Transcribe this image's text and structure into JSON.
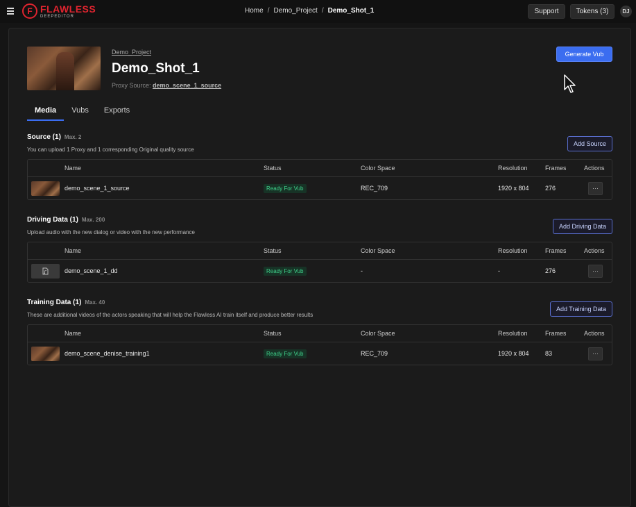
{
  "topbar": {
    "logo_main": "FLAWLESS",
    "logo_sub": "DEEPEDITOR",
    "logo_mark": "F",
    "breadcrumb": [
      "Home",
      "Demo_Project",
      "Demo_Shot_1"
    ],
    "support_label": "Support",
    "tokens_label": "Tokens (3)",
    "avatar_initials": "DJ"
  },
  "shot": {
    "project_link": "Demo_Project",
    "title": "Demo_Shot_1",
    "proxy_label": "Proxy Source:",
    "proxy_value": "demo_scene_1_source",
    "generate_label": "Generate Vub"
  },
  "tabs": [
    {
      "label": "Media",
      "active": true
    },
    {
      "label": "Vubs",
      "active": false
    },
    {
      "label": "Exports",
      "active": false
    }
  ],
  "columns": {
    "name": "Name",
    "status": "Status",
    "color_space": "Color Space",
    "resolution": "Resolution",
    "frames": "Frames",
    "actions": "Actions"
  },
  "sections": [
    {
      "title": "Source (1)",
      "max": "Max. 2",
      "description": "You can upload 1 Proxy and 1 corresponding Original quality source",
      "add_label": "Add Source",
      "rows": [
        {
          "name": "demo_scene_1_source",
          "status": "Ready For Vub",
          "color_space": "REC_709",
          "resolution": "1920 x 804",
          "frames": "276",
          "actions": "···",
          "thumb": "video"
        }
      ]
    },
    {
      "title": "Driving Data (1)",
      "max": "Max. 200",
      "description": "Upload audio with the new dialog or video with the new performance",
      "add_label": "Add Driving Data",
      "rows": [
        {
          "name": "demo_scene_1_dd",
          "status": "Ready For Vub",
          "color_space": "-",
          "resolution": "-",
          "frames": "276",
          "actions": "···",
          "thumb": "audio"
        }
      ]
    },
    {
      "title": "Training Data (1)",
      "max": "Max. 40",
      "description": "These are additional videos of the actors speaking that will help the Flawless AI train itself and produce better results",
      "add_label": "Add Training Data",
      "rows": [
        {
          "name": "demo_scene_denise_training1",
          "status": "Ready For Vub",
          "color_space": "REC_709",
          "resolution": "1920 x 804",
          "frames": "83",
          "actions": "···",
          "thumb": "video"
        }
      ]
    }
  ],
  "icons": {
    "menu": "hamburger-icon",
    "audio_file": "audio-file-icon",
    "cursor": "mouse-pointer-icon"
  },
  "colors": {
    "accent": "#3b6df0",
    "brand": "#e0242f",
    "status_ready": "#3fd08a"
  }
}
